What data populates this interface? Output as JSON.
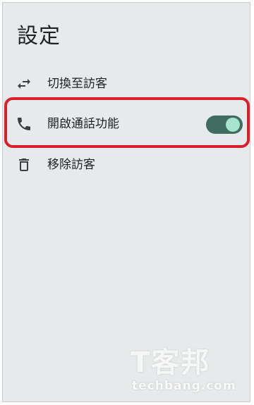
{
  "header": {
    "title": "設定"
  },
  "menu": {
    "items": [
      {
        "label": "切換至訪客",
        "icon": "swap-arrows-icon"
      },
      {
        "label": "開啟通話功能",
        "icon": "phone-icon",
        "toggle_on": true
      },
      {
        "label": "移除訪客",
        "icon": "trash-icon"
      }
    ]
  },
  "colors": {
    "background": "#e7eaeb",
    "toggle_track": "#3f6c5f",
    "toggle_knob": "#a8e3cf",
    "highlight": "#d9202c"
  },
  "watermark": {
    "logo": "T客邦",
    "site": "techbang.com"
  }
}
